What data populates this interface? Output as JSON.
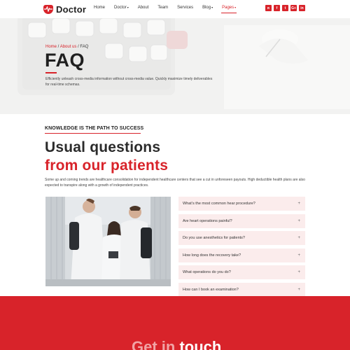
{
  "brand": {
    "name": "Doctor",
    "accent": "#d8232a"
  },
  "nav": {
    "items": [
      {
        "label": "Home",
        "caret": ""
      },
      {
        "label": "Doctor",
        "caret": "▾"
      },
      {
        "label": "About",
        "caret": ""
      },
      {
        "label": "Team",
        "caret": ""
      },
      {
        "label": "Services",
        "caret": ""
      },
      {
        "label": "Blog",
        "caret": "▾"
      },
      {
        "label": "Pages",
        "caret": "▾"
      }
    ],
    "active": "Pages"
  },
  "social": [
    "rss-icon",
    "facebook-icon",
    "twitter-icon",
    "google-plus-icon",
    "linkedin-icon"
  ],
  "social_glyphs": [
    "ʀ",
    "f",
    "t",
    "G+",
    "in"
  ],
  "hero": {
    "breadcrumb": {
      "home": "Home",
      "sep1": " / ",
      "about": "About us",
      "sep2": " / ",
      "current": "FAQ"
    },
    "title": "FAQ",
    "text": "Efficiently unleash cross-media information without cross-media value. Quickly maximize timely deliverables for real-time schemas."
  },
  "section": {
    "kicker": "KNOWLEDGE IS THE PATH TO SUCCESS",
    "heading_line1": "Usual questions",
    "heading_line2": "from our patients",
    "lead": "Some up and coming trends are healthcare consolidation for independent healthcare centers that see a cut in unforeseen payouts. High deductible health plans are also expected to transpire along with a growth of independent practices."
  },
  "faq": [
    {
      "question": "What’s the most common hear procedure?",
      "toggle": "+"
    },
    {
      "question": "Are heart operations painful?",
      "toggle": "+"
    },
    {
      "question": "Do you use anesthetics for patients?",
      "toggle": "+"
    },
    {
      "question": "How long does the recovery take?",
      "toggle": "+"
    },
    {
      "question": "What operations do you do?",
      "toggle": "+"
    },
    {
      "question": "How can I book an examination?",
      "toggle": "+"
    }
  ],
  "cta": {
    "title_part1": "Get in ",
    "title_part2": "touch"
  }
}
